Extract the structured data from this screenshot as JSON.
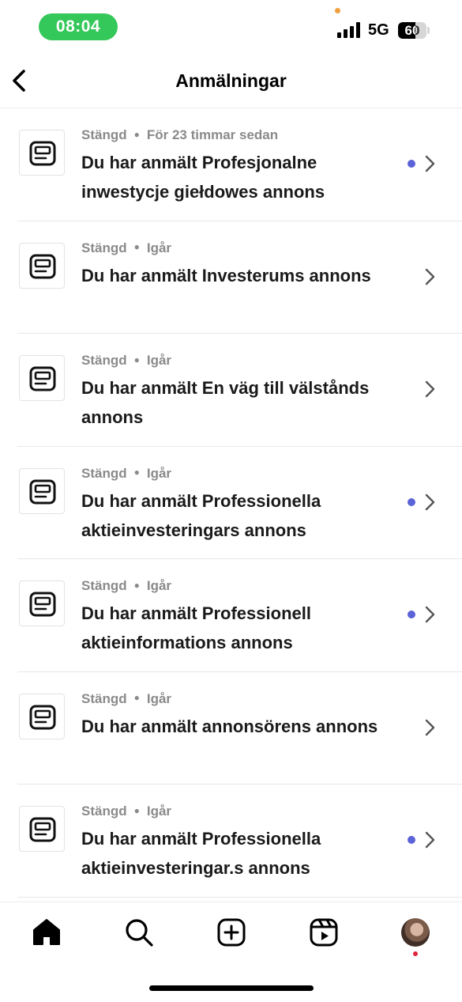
{
  "status_bar": {
    "time": "08:04",
    "network": "5G",
    "battery": "60",
    "battery_level": 0.6
  },
  "header": {
    "title": "Anmälningar",
    "back_icon": "chevron-left-icon"
  },
  "reports": [
    {
      "status": "Stängd",
      "time": "För 23 timmar sedan",
      "title": "Du har anmält Profesjonalne inwestycje giełdowes annons",
      "unread": true
    },
    {
      "status": "Stängd",
      "time": "Igår",
      "title": "Du har anmält Investerums annons",
      "unread": false
    },
    {
      "status": "Stängd",
      "time": "Igår",
      "title": "Du har anmält En väg till välstånds annons",
      "unread": false
    },
    {
      "status": "Stängd",
      "time": "Igår",
      "title": "Du har anmält Professionella aktieinvesteringars annons",
      "unread": true
    },
    {
      "status": "Stängd",
      "time": "Igår",
      "title": "Du har anmält Professionell aktieinformations annons",
      "unread": true
    },
    {
      "status": "Stängd",
      "time": "Igår",
      "title": "Du har anmält annonsörens annons",
      "unread": false
    },
    {
      "status": "Stängd",
      "time": "Igår",
      "title": "Du har anmält Professionella aktieinvesteringar.s annons",
      "unread": true
    }
  ],
  "colors": {
    "accent_unread": "#5b63d8",
    "time_pill": "#34c759",
    "notification": "#e0243a"
  },
  "nav": [
    "home-icon",
    "search-icon",
    "create-icon",
    "reels-icon",
    "profile-avatar"
  ]
}
